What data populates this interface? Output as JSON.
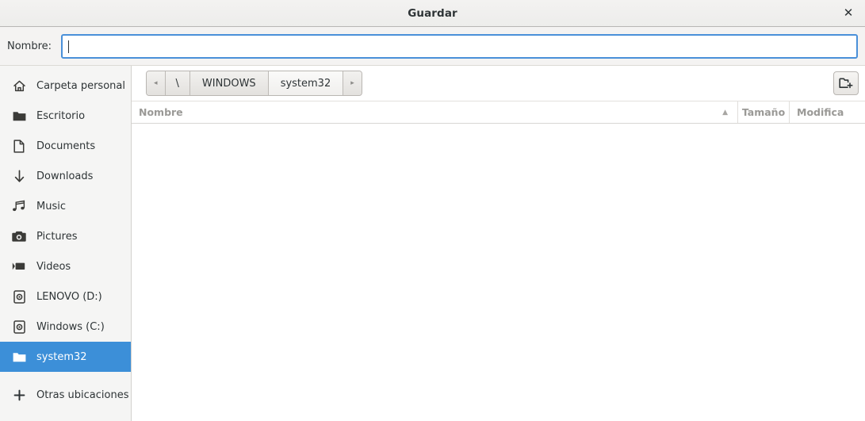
{
  "window": {
    "title": "Guardar",
    "close_label": "✕"
  },
  "name_row": {
    "label": "Nombre:",
    "value": "",
    "placeholder": ""
  },
  "sidebar": {
    "items": [
      {
        "label": "Carpeta personal",
        "icon": "home-icon",
        "selected": false
      },
      {
        "label": "Escritorio",
        "icon": "folder-icon",
        "selected": false
      },
      {
        "label": "Documents",
        "icon": "document-icon",
        "selected": false
      },
      {
        "label": "Downloads",
        "icon": "download-arrow-icon",
        "selected": false
      },
      {
        "label": "Music",
        "icon": "music-note-icon",
        "selected": false
      },
      {
        "label": "Pictures",
        "icon": "camera-icon",
        "selected": false
      },
      {
        "label": "Videos",
        "icon": "video-camera-icon",
        "selected": false
      },
      {
        "label": "LENOVO (D:)",
        "icon": "hard-drive-icon",
        "selected": false
      },
      {
        "label": "Windows (C:)",
        "icon": "hard-drive-icon",
        "selected": false
      },
      {
        "label": "system32",
        "icon": "folder-icon",
        "selected": true
      }
    ],
    "other_locations": {
      "label": "Otras ubicaciones",
      "icon": "plus-icon"
    }
  },
  "pathbar": {
    "back_arrow": "◂",
    "forward_arrow": "▸",
    "crumbs": [
      {
        "label": "\\",
        "active": false
      },
      {
        "label": "WINDOWS",
        "active": false
      },
      {
        "label": "system32",
        "active": true
      }
    ],
    "new_folder_icon": "new-folder-icon"
  },
  "columns": {
    "name": "Nombre",
    "sort_indicator": "▲",
    "size": "Tamaño",
    "modified": "Modifica"
  },
  "file_list": {
    "rows": []
  },
  "colors": {
    "selection": "#3c8fd8",
    "focus_border": "#4a90d9",
    "sidebar_bg": "#f5f5f4",
    "titlebar_bg": "#f0efed",
    "header_text": "#9a9996"
  }
}
